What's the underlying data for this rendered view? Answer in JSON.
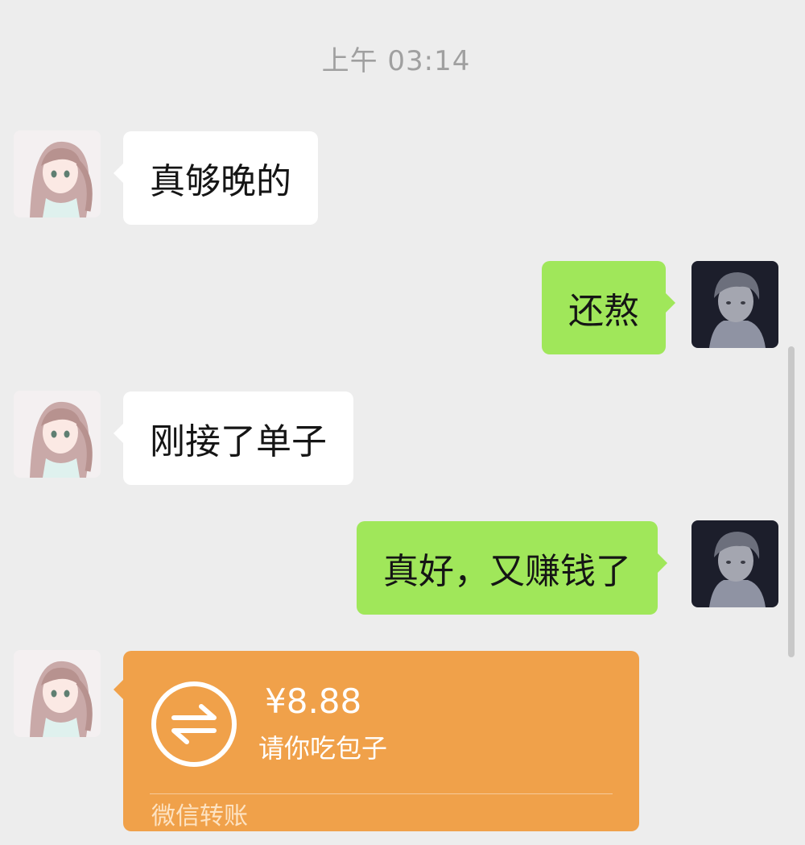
{
  "timestamp": "上午 03:14",
  "messages": [
    {
      "sender": "contact",
      "text": "真够晚的"
    },
    {
      "sender": "me",
      "text": "还熬"
    },
    {
      "sender": "contact",
      "text": "刚接了单子"
    },
    {
      "sender": "me",
      "text": "真好，又赚钱了"
    }
  ],
  "transfer": {
    "amount": "¥8.88",
    "note": "请你吃包子",
    "footer": "微信转账",
    "icon": "transfer-arrows-icon"
  },
  "colors": {
    "background": "#ededed",
    "bubble_incoming": "#ffffff",
    "bubble_outgoing": "#a0e75a",
    "transfer_card": "#f0a14a"
  }
}
